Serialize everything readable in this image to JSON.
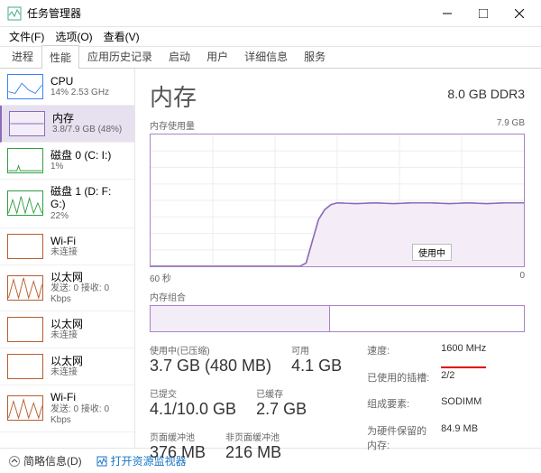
{
  "window": {
    "title": "任务管理器"
  },
  "menu": {
    "file": "文件(F)",
    "options": "选项(O)",
    "view": "查看(V)"
  },
  "tabs": [
    "进程",
    "性能",
    "应用历史记录",
    "启动",
    "用户",
    "详细信息",
    "服务"
  ],
  "active_tab": 1,
  "sidebar": {
    "items": [
      {
        "name": "CPU",
        "detail": "14% 2.53 GHz",
        "color": "#3b82f6"
      },
      {
        "name": "内存",
        "detail": "3.8/7.9 GB (48%)",
        "color": "#8a6db8"
      },
      {
        "name": "磁盘 0 (C: I:)",
        "detail": "1%",
        "color": "#2f9e44"
      },
      {
        "name": "磁盘 1 (D: F: G:)",
        "detail": "22%",
        "color": "#2f9e44"
      },
      {
        "name": "Wi-Fi",
        "detail": "未连接",
        "color": "#b85c2e"
      },
      {
        "name": "以太网",
        "detail": "发送: 0 接收: 0 Kbps",
        "color": "#b85c2e"
      },
      {
        "name": "以太网",
        "detail": "未连接",
        "color": "#b85c2e"
      },
      {
        "name": "以太网",
        "detail": "未连接",
        "color": "#b85c2e"
      },
      {
        "name": "Wi-Fi",
        "detail": "发送: 0 接收: 0 Kbps",
        "color": "#b85c2e"
      }
    ],
    "selected": 1
  },
  "main": {
    "title": "内存",
    "spec": "8.0 GB DDR3",
    "usage_label": "内存使用量",
    "usage_max": "7.9 GB",
    "xaxis_left": "60 秒",
    "xaxis_right": "0",
    "usage_tag": "使用中",
    "composition_label": "内存组合",
    "stats": {
      "in_use_label": "使用中(已压缩)",
      "in_use": "3.7 GB (480 MB)",
      "available_label": "可用",
      "available": "4.1 GB",
      "committed_label": "已提交",
      "committed": "4.1/10.0 GB",
      "cached_label": "已缓存",
      "cached": "2.7 GB",
      "paged_label": "页面缓冲池",
      "paged": "376 MB",
      "nonpaged_label": "非页面缓冲池",
      "nonpaged": "216 MB"
    },
    "kv": {
      "speed_k": "速度:",
      "speed_v": "1600 MHz",
      "slots_k": "已使用的插槽:",
      "slots_v": "2/2",
      "form_k": "组成要素:",
      "form_v": "SODIMM",
      "reserved_k": "为硬件保留的内存:",
      "reserved_v": "84.9 MB"
    }
  },
  "status": {
    "less_details": "简略信息(D)",
    "resmon": "打开资源监视器"
  },
  "chart_data": {
    "type": "area",
    "title": "内存使用量",
    "ylabel": "GB",
    "ylim": [
      0,
      7.9
    ],
    "x": [
      60,
      57,
      54,
      51,
      48,
      45,
      42,
      39,
      36,
      35,
      34,
      33,
      32,
      31,
      30,
      27,
      24,
      21,
      18,
      15,
      12,
      9,
      6,
      3,
      0
    ],
    "values": [
      0,
      0,
      0,
      0,
      0,
      0,
      0,
      0,
      0,
      0.2,
      1.5,
      2.8,
      3.4,
      3.7,
      3.8,
      3.75,
      3.8,
      3.75,
      3.8,
      3.8,
      3.75,
      3.8,
      3.75,
      3.8,
      3.8
    ]
  }
}
